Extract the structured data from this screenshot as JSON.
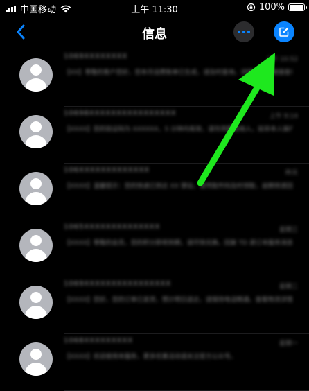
{
  "status_bar": {
    "carrier": "中国移动",
    "time": "上午 11:30",
    "battery_text": "100%",
    "battery_level_fraction": 1.0
  },
  "nav": {
    "title": "信息",
    "back_icon": "chevron-left-icon",
    "more_icon": "ellipsis-icon",
    "compose_icon": "compose-icon",
    "accent_color": "#0a84ff"
  },
  "annotation": {
    "arrow_color": "#1ee81e",
    "points_to": "compose-button"
  },
  "messages": [
    {
      "name": "1069XXXXXXXX",
      "time": "上午 10:52",
      "preview": "【XX】尊敬的客户您好，您本月话费账单已生成，请及时查询。详情请点击链接查看更多内容。"
    },
    {
      "name": "10698XXXXXXXXXXXXXXXX",
      "time": "上午 9:14",
      "preview": "【XXXX】您的验证码为 XXXXXX，5 分钟内有效，请勿泄露给他人。如非本人操作请忽略本短信。"
    },
    {
      "name": "106XXXXXXXXXXXXX",
      "time": "昨天",
      "preview": "【XXXX】温馨提示：您的快递已到达 XX 驿站，请凭取件码及时领取，逾期将退回。谢谢合作。"
    },
    {
      "name": "1065XXXXXXXXXXXXXX",
      "time": "星期三",
      "preview": "【XXXX】尊敬的会员，您的积分即将到期，请尽快兑换。回复 TD 退订本服务消息。"
    },
    {
      "name": "1069XXXXXXXXXXXXXXXX",
      "time": "星期二",
      "preview": "【XXXX】您好，您的订单已发货，预计明日送达，请保持电话畅通。查看物流详情请访问官网。"
    },
    {
      "name": "1068XXXXXXXXX",
      "time": "星期一",
      "preview": "【XXXX】欢迎使用本服务，更多优惠活动请关注官方公众号。"
    }
  ]
}
